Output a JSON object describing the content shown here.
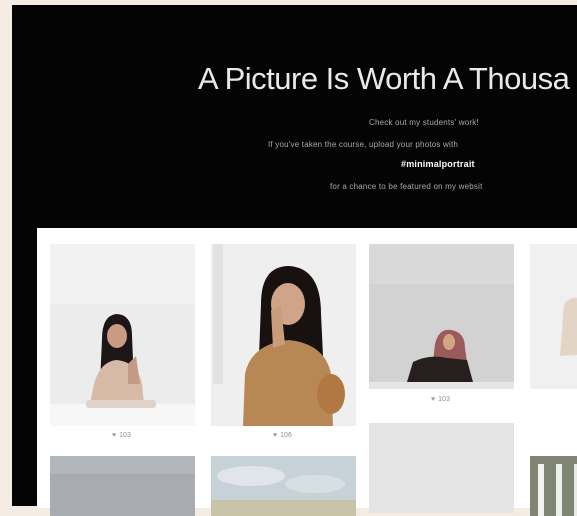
{
  "hero": {
    "title": "A Picture Is Worth A Thousa",
    "line1": "Check out my students' work!",
    "line2": "If you've taken the course, upload your photos with",
    "hashtag": "#minimalportrait",
    "line4": "for a chance to be featured on my websit"
  },
  "gallery": {
    "items": [
      {
        "likes": "103",
        "icon": "heart-icon"
      },
      {
        "likes": "106",
        "icon": "heart-icon"
      },
      {
        "likes": "103",
        "icon": "heart-icon"
      }
    ]
  },
  "colors": {
    "page_background": "#f4ebe3",
    "hero_background": "#040404",
    "gallery_background": "#ffffff",
    "title_text": "#e9e9e9"
  }
}
